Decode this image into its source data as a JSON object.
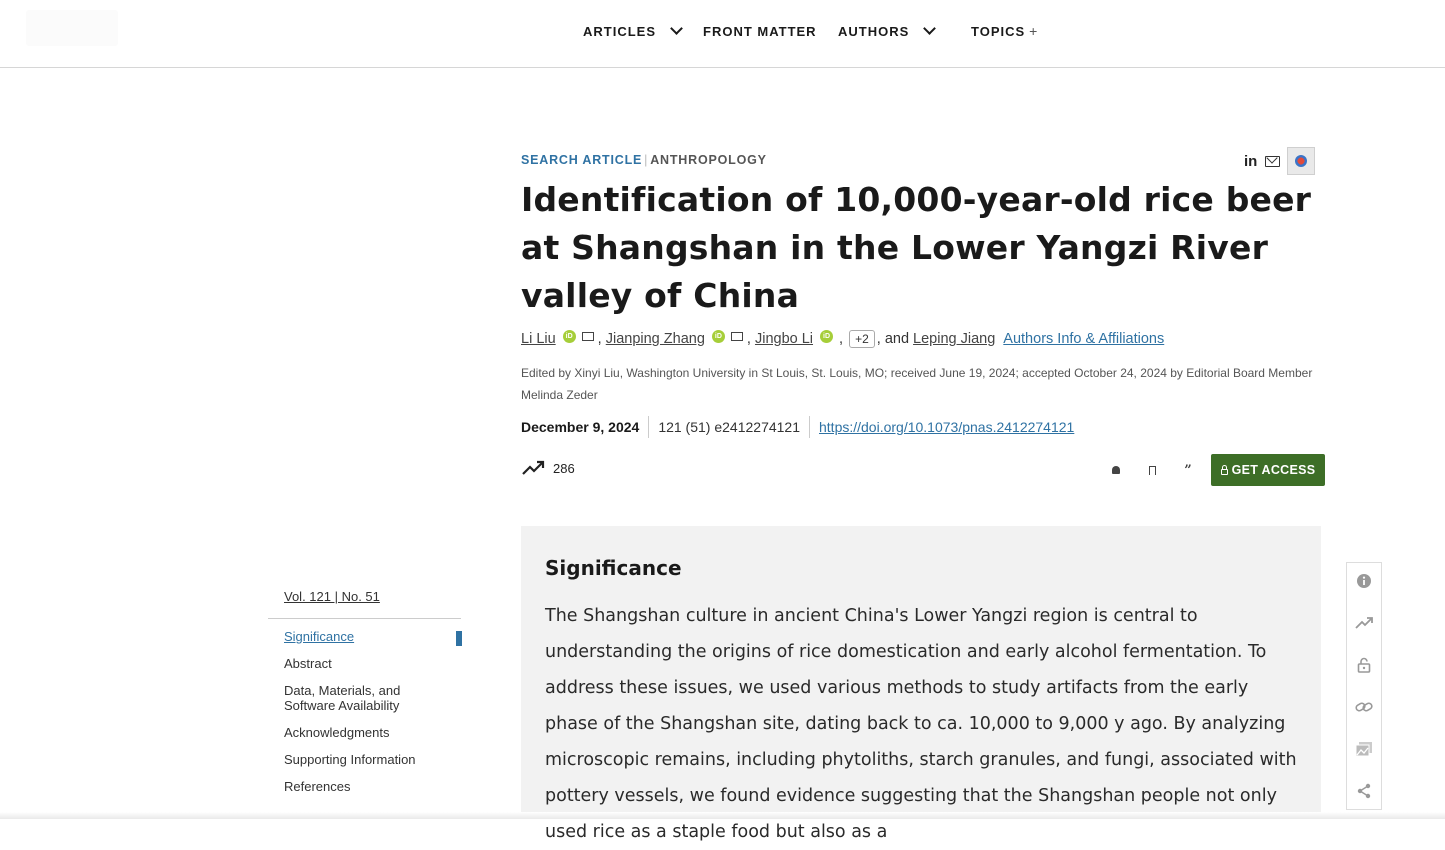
{
  "nav": {
    "articles": "ARTICLES",
    "front_matter": "FRONT MATTER",
    "authors": "AUTHORS",
    "topics": "TOPICS",
    "topics_suffix": "+"
  },
  "article": {
    "kicker_type": "SEARCH ARTICLE",
    "kicker_sep": "|",
    "kicker_topic": "ANTHROPOLOGY",
    "share_linkedin": "in",
    "title": "Identification of 10,000-year-old rice beer at Shangshan in the Lower Yangzi River valley of China",
    "authors": {
      "a1": "Li Liu",
      "a2": "Jianping Zhang",
      "a3": "Jingbo Li",
      "more": "+2",
      "and": ", and",
      "a4": "Leping Jiang",
      "comma": ",",
      "affiliations_link": "Authors Info & Affiliations",
      "orcid_glyph": "iD"
    },
    "edited_by": "Edited by Xinyi Liu, Washington University in St Louis, St. Louis, MO; received June 19, 2024; accepted October 24, 2024 by Editorial Board Member Melinda Zeder",
    "date": "December 9, 2024",
    "citation": "121 (51) e2412274121",
    "doi": "https://doi.org/10.1073/pnas.2412274121",
    "metric_count": "286",
    "get_access": "GET ACCESS"
  },
  "significance": {
    "heading": "Significance",
    "body": "The Shangshan culture in ancient China's Lower Yangzi region is central to understanding the origins of rice domestication and early alcohol fermentation. To address these issues, we used various methods to study artifacts from the early phase of the Shangshan site, dating back to ca. 10,000 to 9,000 y ago. By analyzing microscopic remains, including phytoliths, starch granules, and fungi, associated with pottery vessels, we found evidence suggesting that the Shangshan people not only used rice as a staple food but also as a"
  },
  "toc": {
    "volume": "Vol. 121 | No. 51",
    "items": [
      "Significance",
      "Abstract",
      "Data, Materials, and Software Availability",
      "Acknowledgments",
      "Supporting Information",
      "References"
    ]
  },
  "colors": {
    "accent": "#2f72a3",
    "access_button": "#3d6e27",
    "orcid": "#a6ce39",
    "panel_bg": "#f2f2f2"
  },
  "icons": {
    "nav_chevron": "chevron-down-icon",
    "metric": "trending-up-icon",
    "tools": [
      "bell-icon",
      "bookmark-icon",
      "quote-icon"
    ],
    "right_toolbar": [
      "info-icon",
      "trending-up-icon",
      "lock-icon",
      "link-icon",
      "image-icon",
      "share-icon"
    ]
  }
}
